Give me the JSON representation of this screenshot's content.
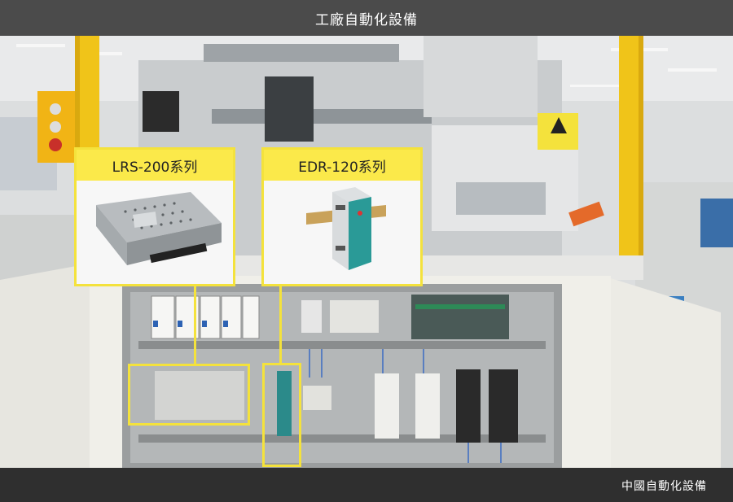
{
  "header": {
    "title": "工廠自動化設備"
  },
  "footer": {
    "caption": "中國自動化設備"
  },
  "callouts": [
    {
      "label": "LRS-200系列",
      "product": "enclosed switching power supply"
    },
    {
      "label": "EDR-120系列",
      "product": "DIN rail power supply"
    }
  ],
  "colors": {
    "highlight": "#f4e23c",
    "label_bg": "#fbe94a",
    "header_bg": "#4b4b4b",
    "footer_bg": "#2f2f2f"
  }
}
